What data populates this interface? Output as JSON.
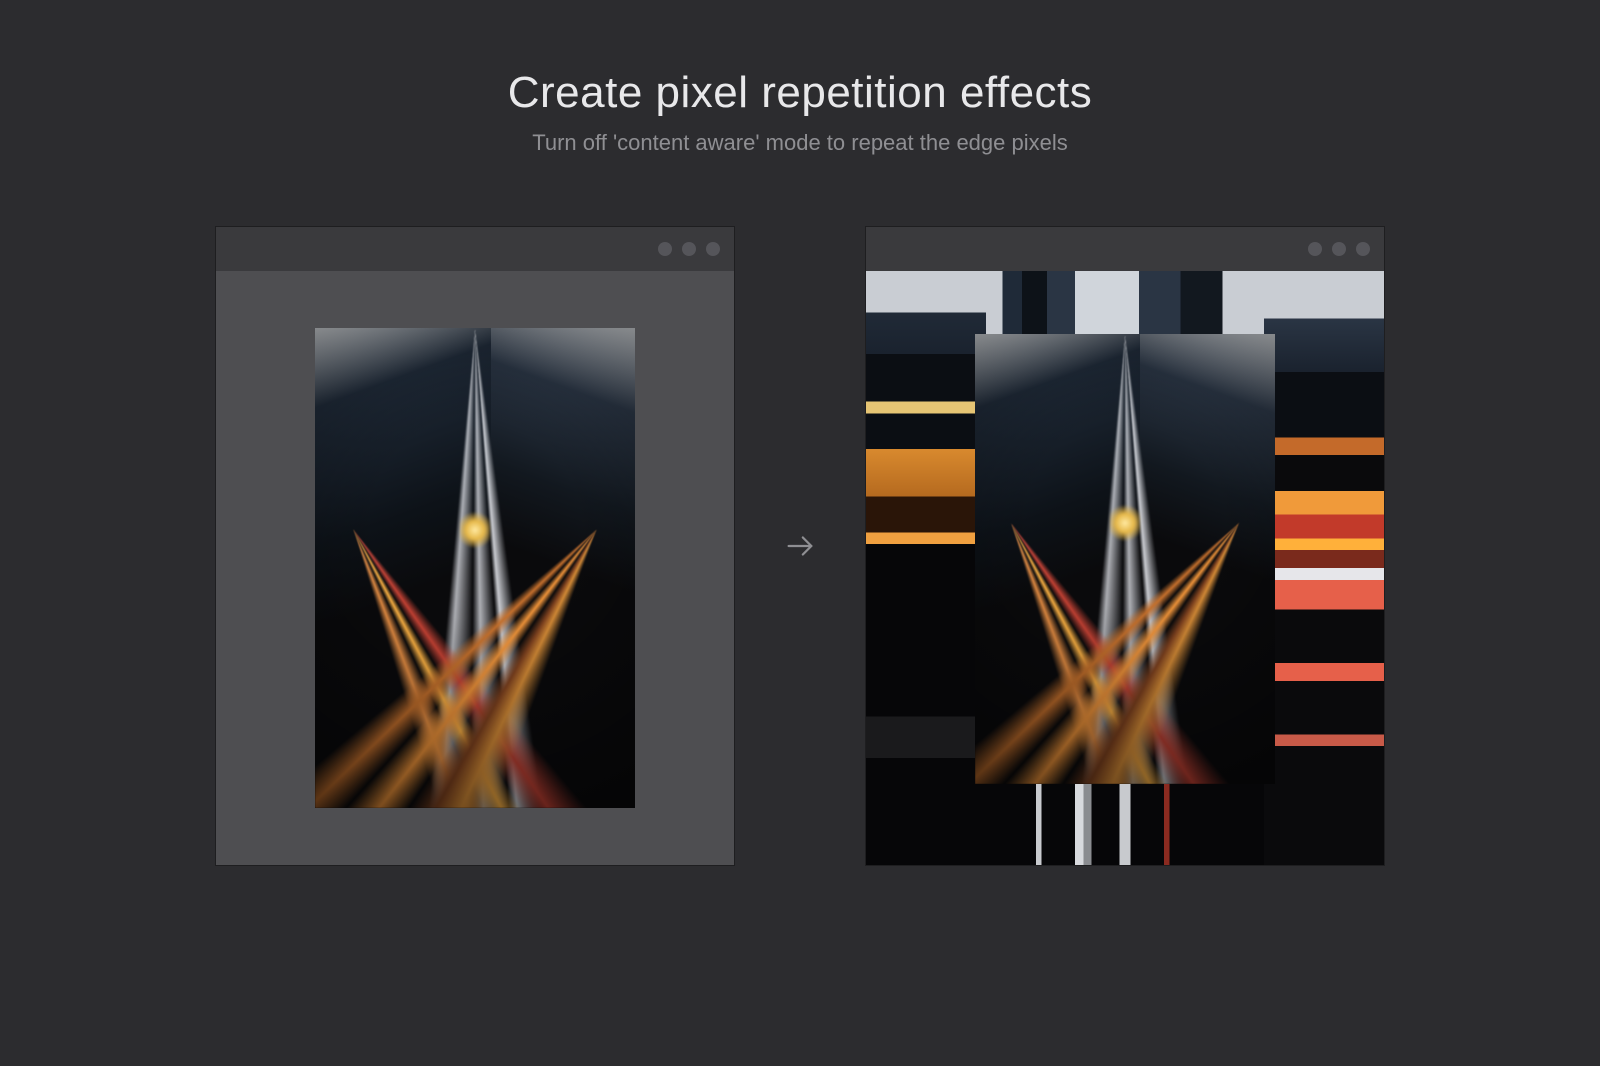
{
  "heading": {
    "title": "Create pixel repetition effects",
    "subtitle": "Turn off 'content aware' mode to repeat the edge pixels"
  },
  "arrow_glyph": "→",
  "windows": {
    "left": {
      "label": "original-image-window"
    },
    "right": {
      "label": "extended-image-window"
    }
  }
}
